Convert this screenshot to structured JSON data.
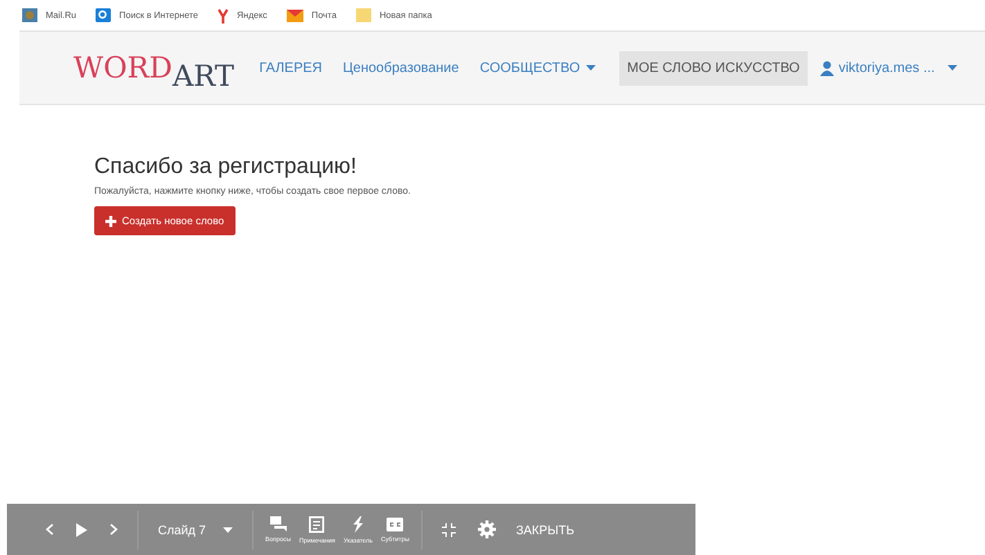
{
  "bookmarks": [
    {
      "label": "Mail.Ru"
    },
    {
      "label": "Поиск в Интернете"
    },
    {
      "label": "Яндекс"
    },
    {
      "label": "Почта"
    },
    {
      "label": "Новая папка"
    }
  ],
  "logo": {
    "part_1": "WORD",
    "part_2": "ART"
  },
  "nav": [
    {
      "label": "ГАЛЕРЕЯ",
      "selected": false,
      "dropdown": false
    },
    {
      "label": "Ценообразование",
      "selected": false,
      "dropdown": false
    },
    {
      "label": "СООБЩЕСТВО",
      "selected": false,
      "dropdown": true
    },
    {
      "label": "МОЕ СЛОВО ИСКУССТВО",
      "selected": true,
      "dropdown": false
    }
  ],
  "user": {
    "label": "viktoriya.mes ..."
  },
  "main": {
    "title": "Спасибо за регистрацию!",
    "text": "Пожалуйста, нажмите кнопку ниже, чтобы создать свое первое слово.",
    "button": "Создать новое слово"
  },
  "player": {
    "slide": "Слайд 7",
    "tools": [
      {
        "label": "Вопросы"
      },
      {
        "label": "Примечания"
      },
      {
        "label": "Указатель"
      },
      {
        "label": "Субтитры"
      }
    ],
    "close": "ЗАКРЫТЬ"
  }
}
